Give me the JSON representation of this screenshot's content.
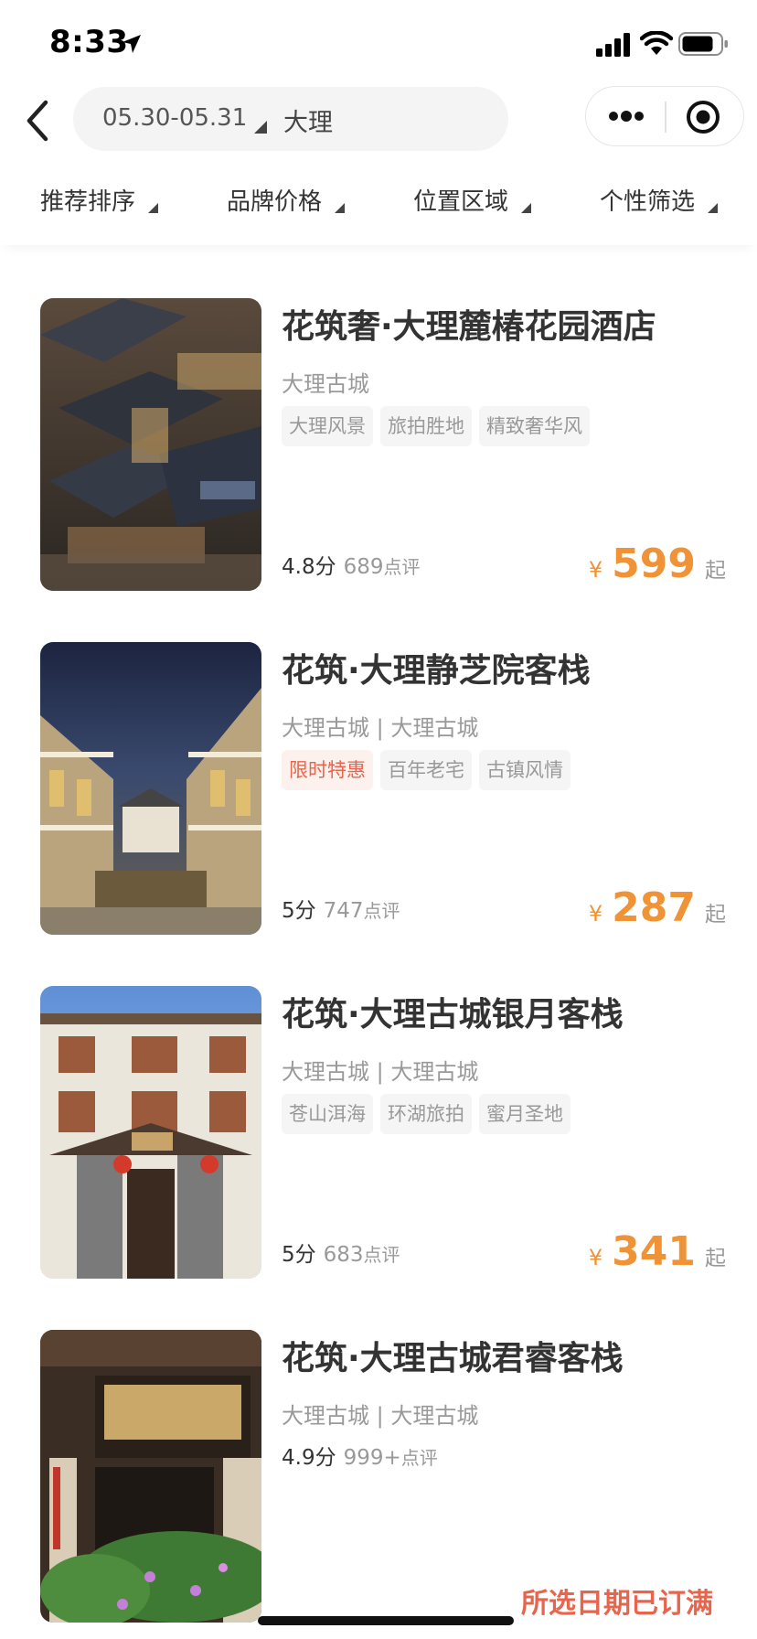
{
  "status_bar": {
    "time": "8:33"
  },
  "header": {
    "dates": "05.30-05.31",
    "city": "大理"
  },
  "filters": [
    {
      "label": "推荐排序"
    },
    {
      "label": "品牌价格"
    },
    {
      "label": "位置区域"
    },
    {
      "label": "个性筛选"
    }
  ],
  "hotels": [
    {
      "name": "花筑奢·大理麓椿花园酒店",
      "location": "大理古城",
      "tags": [
        "大理风景",
        "旅拍胜地",
        "精致奢华风"
      ],
      "score": "4.8分",
      "reviews": "689",
      "reviews_suffix": "点评",
      "currency": "¥",
      "price": "599",
      "price_suffix": "起"
    },
    {
      "name": "花筑·大理静芝院客栈",
      "location": "大理古城 | 大理古城",
      "tags": [
        "限时特惠",
        "百年老宅",
        "古镇风情"
      ],
      "score": "5分",
      "reviews": "747",
      "reviews_suffix": "点评",
      "currency": "¥",
      "price": "287",
      "price_suffix": "起"
    },
    {
      "name": "花筑·大理古城银月客栈",
      "location": "大理古城 | 大理古城",
      "tags": [
        "苍山洱海",
        "环湖旅拍",
        "蜜月圣地"
      ],
      "score": "5分",
      "reviews": "683",
      "reviews_suffix": "点评",
      "currency": "¥",
      "price": "341",
      "price_suffix": "起"
    },
    {
      "name": "花筑·大理古城君睿客栈",
      "location": "大理古城 | 大理古城",
      "score": "4.9分",
      "reviews": "999+",
      "reviews_suffix": "点评",
      "status": "所选日期已订满"
    }
  ],
  "icons": {
    "back": "chevron-left-icon",
    "more": "more-dots-icon",
    "target": "target-icon",
    "location_arrow": "location-arrow-icon",
    "signal": "cellular-signal-icon",
    "wifi": "wifi-icon",
    "battery": "battery-icon"
  },
  "colors": {
    "price": "#f09236",
    "promo_tag": "#e8654d",
    "soldout": "#e8654d",
    "tag_bg": "#f5f5f5"
  }
}
